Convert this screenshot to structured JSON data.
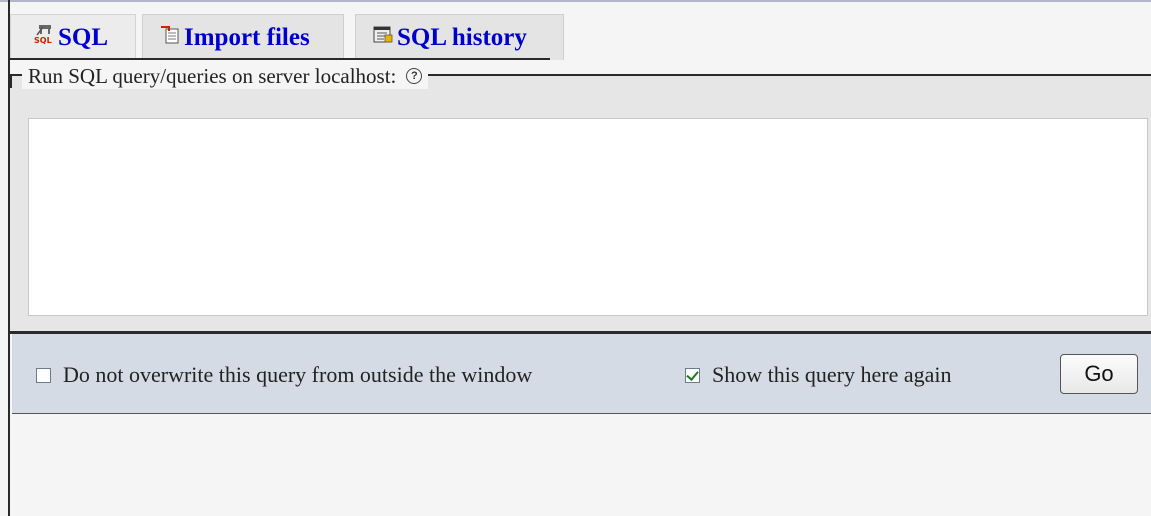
{
  "tabs": [
    {
      "label": "SQL",
      "icon": "sql-icon",
      "active": true
    },
    {
      "label": "Import files",
      "icon": "import-files-icon",
      "active": false
    },
    {
      "label": "SQL history",
      "icon": "sql-history-icon",
      "active": false
    }
  ],
  "query_panel": {
    "legend": "Run SQL query/queries on server localhost:",
    "help_icon": "help-icon",
    "query_value": ""
  },
  "options": {
    "no_overwrite_label": "Do not overwrite this query from outside the window",
    "no_overwrite_checked": false,
    "show_again_label": "Show this query here again",
    "show_again_checked": true,
    "go_label": "Go"
  },
  "colors": {
    "tab_link": "#0000cc",
    "options_bg": "#d4dbe4",
    "panel_bg": "#e6e6e6"
  }
}
